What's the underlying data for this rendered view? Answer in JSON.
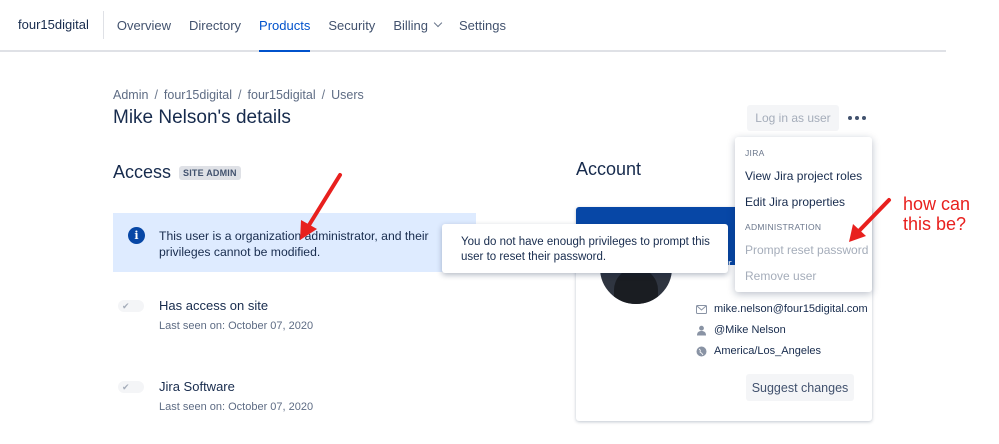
{
  "topnav": {
    "brand": "four15digital",
    "items": [
      {
        "label": "Overview",
        "active": false
      },
      {
        "label": "Directory",
        "active": false
      },
      {
        "label": "Products",
        "active": true
      },
      {
        "label": "Security",
        "active": false
      },
      {
        "label": "Billing",
        "active": false,
        "has_dropdown": true
      },
      {
        "label": "Settings",
        "active": false
      }
    ]
  },
  "breadcrumb": [
    "Admin",
    "four15digital",
    "four15digital",
    "Users"
  ],
  "page_title": "Mike Nelson's details",
  "actions": {
    "login_as_user": "Log in as user",
    "more_icon": "ellipsis-icon"
  },
  "access": {
    "title": "Access",
    "badge": "SITE ADMIN",
    "banner_text": "This user is a organization administrator, and their privileges cannot be modified.",
    "items": [
      {
        "title": "Has access on site",
        "subtitle": "Last seen on: October 07, 2020",
        "toggled": true,
        "disabled": true
      },
      {
        "title": "Jira Software",
        "subtitle": "Last seen on: October 07, 2020",
        "toggled": true,
        "disabled": true
      }
    ]
  },
  "account": {
    "title": "Account",
    "header_fragment": "r",
    "email": "mike.nelson@four15digital.com",
    "handle": "@Mike Nelson",
    "timezone": "America/Los_Angeles",
    "suggest_button": "Suggest changes"
  },
  "tooltip": "You do not have enough privileges to prompt this user to reset their password.",
  "dropdown": {
    "group1": "JIRA",
    "view_roles": "View Jira project roles",
    "edit_props": "Edit Jira properties",
    "group2": "ADMINISTRATION",
    "prompt_reset": "Prompt reset password",
    "remove_user": "Remove user"
  },
  "annotation": {
    "line1": "how can",
    "line2": "this be?",
    "color": "#e8201e"
  },
  "colors": {
    "primary": "#0052cc",
    "banner": "#deebff",
    "card_header": "#0747a6",
    "text": "#172b4d",
    "muted": "#5e6c84",
    "disabled": "#a5adba"
  }
}
